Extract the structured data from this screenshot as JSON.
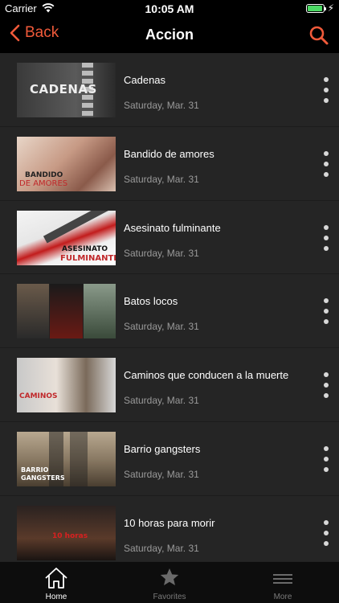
{
  "status_bar": {
    "carrier": "Carrier",
    "time": "10:05 AM"
  },
  "nav": {
    "back_label": "Back",
    "title": "Accion"
  },
  "colors": {
    "accent": "#f05a3a",
    "list_bg": "#252525",
    "date_text": "#9a9a9a"
  },
  "items": [
    {
      "title": "Cadenas",
      "date": "Saturday, Mar. 31",
      "poster_text": "CADENAS"
    },
    {
      "title": "Bandido de amores",
      "date": "Saturday, Mar. 31",
      "poster_text": "BANDIDO",
      "poster_text2": "DE AMORES"
    },
    {
      "title": "Asesinato fulminante",
      "date": "Saturday, Mar. 31",
      "poster_text": "ASESINATO",
      "poster_text2": "FULMINANTE"
    },
    {
      "title": "Batos locos",
      "date": "Saturday, Mar. 31"
    },
    {
      "title": "Caminos que conducen a la muerte",
      "date": "Saturday, Mar. 31",
      "poster_text": "CAMINOS"
    },
    {
      "title": "Barrio gangsters",
      "date": "Saturday, Mar. 31",
      "poster_text": "BARRIO",
      "poster_text2": "GANGSTERS"
    },
    {
      "title": "10 horas para morir",
      "date": "Saturday, Mar. 31",
      "poster_text": "10 horas"
    }
  ],
  "tabs": [
    {
      "label": "Home",
      "icon": "home-icon",
      "active": true
    },
    {
      "label": "Favorites",
      "icon": "star-icon",
      "active": false
    },
    {
      "label": "More",
      "icon": "more-lines-icon",
      "active": false
    }
  ]
}
